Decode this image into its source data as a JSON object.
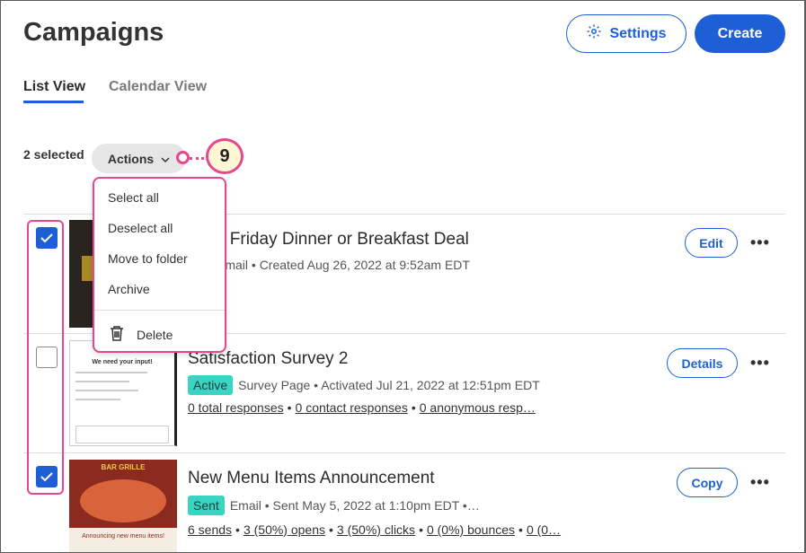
{
  "header": {
    "title": "Campaigns",
    "settings_label": "Settings",
    "create_label": "Create"
  },
  "tabs": [
    {
      "label": "List View",
      "active": true
    },
    {
      "label": "Calendar View",
      "active": false
    }
  ],
  "toolbar": {
    "selected_text": "2 selected",
    "actions_label": "Actions",
    "callout_number": "9"
  },
  "actions_menu": {
    "items": [
      "Select all",
      "Deselect all",
      "Move to folder",
      "Archive"
    ],
    "delete_label": "Delete"
  },
  "rows": [
    {
      "checked": true,
      "title": "k Friday Dinner or Breakfast Deal",
      "meta": "Email  •  Created Aug 26, 2022 at 9:52am EDT",
      "button": "Edit"
    },
    {
      "checked": false,
      "title": "Satisfaction Survey 2",
      "badge": "Active",
      "meta": "Survey Page  •  Activated Jul 21, 2022 at 12:51pm EDT",
      "links": [
        "0 total responses",
        "0 contact responses",
        "0 anonymous resp…"
      ],
      "button": "Details",
      "thumb_text": "We need your input!"
    },
    {
      "checked": true,
      "title": "New Menu Items Announcement",
      "badge": "Sent",
      "meta": "Email  •  Sent May 5, 2022 at 1:10pm EDT  •…",
      "links": [
        "6 sends",
        "3 (50%) opens",
        "3 (50%) clicks",
        "0 (0%) bounces",
        "0 (0…"
      ],
      "button": "Copy",
      "thumb_brand": "BAR GRILLE",
      "thumb_text": "Announcing new menu items!"
    }
  ],
  "colors": {
    "brand_blue": "#1f5fd6",
    "highlight_pink": "#e6488f",
    "badge_teal": "#3ad4c3"
  }
}
